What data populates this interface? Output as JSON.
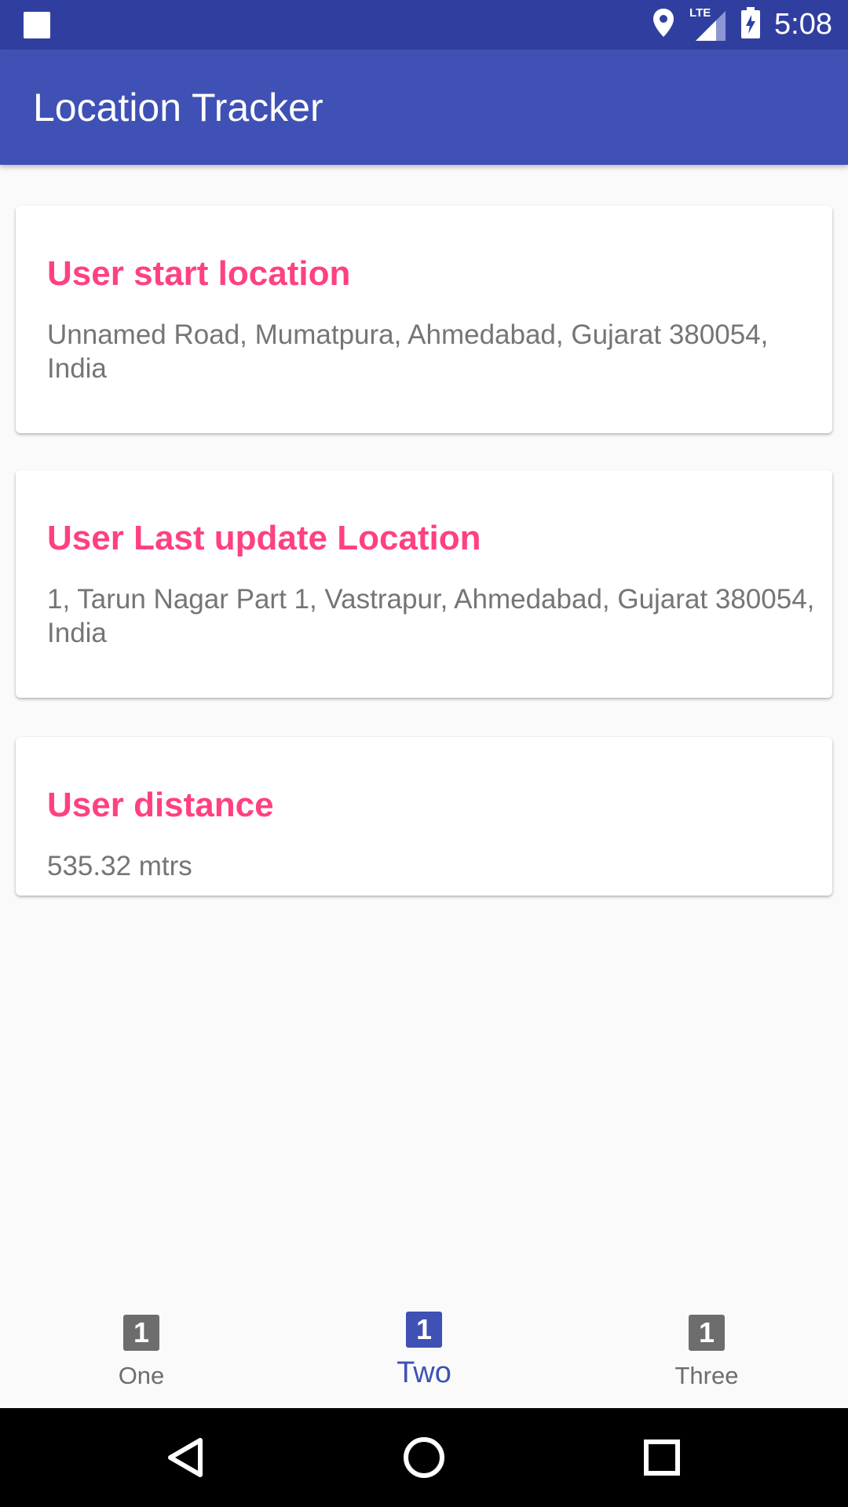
{
  "status_bar": {
    "time": "5:08",
    "network_label": "LTE",
    "icons": [
      "notification-square-icon",
      "location-pin-icon",
      "lte-signal-icon",
      "battery-charging-icon"
    ]
  },
  "app_bar": {
    "title": "Location Tracker"
  },
  "cards": [
    {
      "title": "User start location",
      "body": "Unnamed Road, Mumatpura, Ahmedabad, Gujarat 380054, India"
    },
    {
      "title": "User Last update Location",
      "body": "1, Tarun Nagar Part 1, Vastrapur, Ahmedabad, Gujarat 380054, India"
    },
    {
      "title": "User distance",
      "body": "535.32 mtrs"
    }
  ],
  "bottom_nav": {
    "items": [
      {
        "label": "One",
        "icon_glyph": "1",
        "active": false
      },
      {
        "label": "Two",
        "icon_glyph": "1",
        "active": true
      },
      {
        "label": "Three",
        "icon_glyph": "1",
        "active": false
      }
    ]
  },
  "system_nav": {
    "icons": [
      "back-triangle-icon",
      "home-circle-icon",
      "recents-square-icon"
    ]
  },
  "colors": {
    "status_bar": "#303f9f",
    "primary": "#3f51b5",
    "accent": "#ff4081",
    "body_text": "#757575",
    "inactive_nav": "#6d6d6d"
  }
}
